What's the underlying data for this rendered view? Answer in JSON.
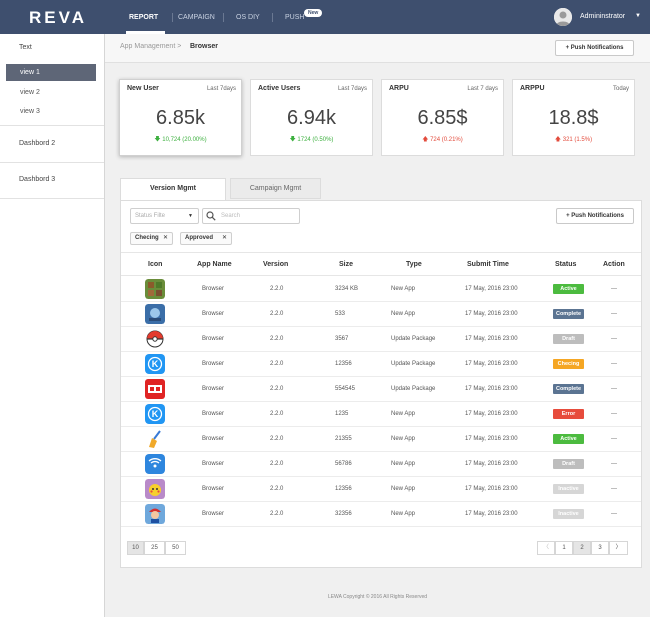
{
  "header": {
    "logo": "REVA",
    "nav": [
      "REPORT",
      "CAMPAIGN",
      "OS DIY",
      "PUSH"
    ],
    "new_badge": "New",
    "username": "Admininstrator"
  },
  "sidebar": {
    "title": "Text",
    "items": [
      "view 1",
      "view 2",
      "view 3"
    ],
    "groups": [
      "Dashbord 2",
      "Dashbord 3"
    ]
  },
  "breadcrumb": {
    "parent": "App Management >",
    "current": "Browser"
  },
  "push_button": "+ Push Notifications",
  "cards": [
    {
      "title": "New User",
      "period": "Last 7days",
      "value": "6.85k",
      "change": "10,724 (20.00%)",
      "direction": "down"
    },
    {
      "title": "Active Users",
      "period": "Last 7days",
      "value": "6.94k",
      "change": "1724 (0.50%)",
      "direction": "down"
    },
    {
      "title": "ARPU",
      "period": "Last 7 days",
      "value": "6.85$",
      "change": "724 (0.21%)",
      "direction": "up"
    },
    {
      "title": "ARPPU",
      "period": "Today",
      "value": "18.8$",
      "change": "321  (1.5%)",
      "direction": "up"
    }
  ],
  "tabs": [
    "Version Mgmt",
    "Campaign Mgmt"
  ],
  "filters": {
    "status_placeholder": "Status Filte",
    "search_placeholder": "Search",
    "chips": [
      "Checing",
      "Approved"
    ]
  },
  "table": {
    "headers": [
      "Icon",
      "App Name",
      "Version",
      "Size",
      "Type",
      "Submit Time",
      "Status",
      "Action"
    ],
    "rows": [
      {
        "icon": "minecraft-icon",
        "app": "Browser",
        "version": "2.2.0",
        "size": "3234 KB",
        "type": "New App",
        "time": "17 May, 2016 23:00",
        "status": "Active",
        "action": "---"
      },
      {
        "icon": "game-icon",
        "app": "Browser",
        "version": "2.2.0",
        "size": "533",
        "type": "New App",
        "time": "17 May, 2016 23:00",
        "status": "Complete",
        "action": "---"
      },
      {
        "icon": "pokeball-icon",
        "app": "Browser",
        "version": "2.2.0",
        "size": "3567",
        "type": "Update Package",
        "time": "17 May, 2016 23:00",
        "status": "Draft",
        "action": "---"
      },
      {
        "icon": "k-app-icon",
        "app": "Browser",
        "version": "2.2.0",
        "size": "12356",
        "type": "Update Package",
        "time": "17 May, 2016 23:00",
        "status": "Checing",
        "action": "---"
      },
      {
        "icon": "toutiao-icon",
        "app": "Browser",
        "version": "2.2.0",
        "size": "554545",
        "type": "Update Package",
        "time": "17 May, 2016 23:00",
        "status": "Complete",
        "action": "---"
      },
      {
        "icon": "k-app-icon",
        "app": "Browser",
        "version": "2.2.0",
        "size": "1235",
        "type": "New App",
        "time": "17 May, 2016 23:00",
        "status": "Error",
        "action": "---"
      },
      {
        "icon": "broom-icon",
        "app": "Browser",
        "version": "2.2.0",
        "size": "21355",
        "type": "New App",
        "time": "17 May, 2016 23:00",
        "status": "Active",
        "action": "---"
      },
      {
        "icon": "wifi-icon",
        "app": "Browser",
        "version": "2.2.0",
        "size": "56786",
        "type": "New App",
        "time": "17 May, 2016 23:00",
        "status": "Draft",
        "action": "---"
      },
      {
        "icon": "pikachu-icon",
        "app": "Browser",
        "version": "2.2.0",
        "size": "12356",
        "type": "New App",
        "time": "17 May, 2016 23:00",
        "status": "Inactive",
        "action": "---"
      },
      {
        "icon": "mario-icon",
        "app": "Browser",
        "version": "2.2.0",
        "size": "32356",
        "type": "New App",
        "time": "17 May, 2016 23:00",
        "status": "Inactive",
        "action": "---"
      }
    ]
  },
  "page_sizes": [
    "10",
    "25",
    "50"
  ],
  "pages": [
    "1",
    "2",
    "3"
  ],
  "footer": "LEWA Copyright © 2016 All Rights Reserved",
  "colors": {
    "topbar": "#3e4f6e",
    "Active": "#4cbb3f",
    "Complete": "#5b7492",
    "Draft": "#bdbdbd",
    "Checing": "#f5a623",
    "Error": "#e74c3c",
    "Inactive": "#d6d6d6"
  }
}
